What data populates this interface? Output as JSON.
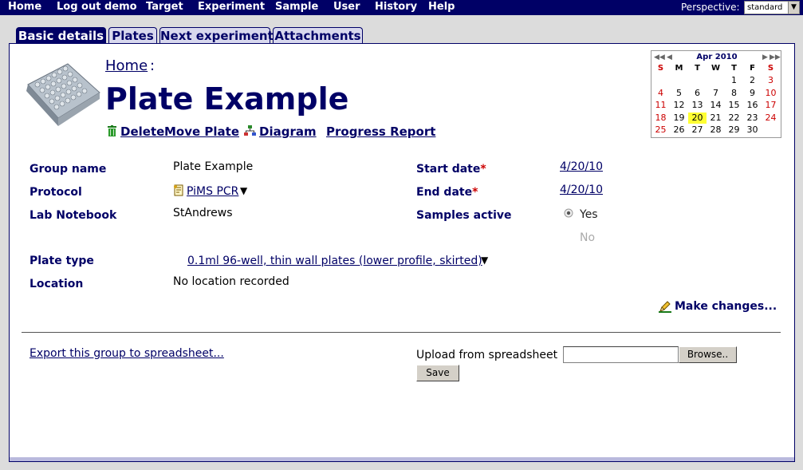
{
  "nav": {
    "items": [
      "Home",
      "Log out demo",
      "Target",
      "Experiment",
      "Sample",
      "User",
      "History",
      "Help"
    ],
    "perspective_label": "Perspective:",
    "perspective_value": "standard"
  },
  "tabs": [
    "Basic details",
    "Plates",
    "Next experiment",
    "Attachments"
  ],
  "breadcrumb": {
    "home": "Home",
    "sep": ":"
  },
  "title": "Plate Example",
  "actions": {
    "delete": "Delete",
    "move": "Move Plate",
    "diagram": "Diagram",
    "progress": "Progress Report"
  },
  "fields": {
    "group_name": {
      "label": "Group name",
      "value": "Plate Example"
    },
    "protocol": {
      "label": "Protocol",
      "value": "PiMS PCR"
    },
    "notebook": {
      "label": "Lab Notebook",
      "value": "StAndrews"
    },
    "plate_type": {
      "label": "Plate type",
      "value": "0.1ml 96-well, thin wall plates (lower profile, skirted)"
    },
    "location": {
      "label": "Location",
      "value": "No location recorded"
    },
    "start_date": {
      "label": "Start date",
      "value": "4/20/10"
    },
    "end_date": {
      "label": "End date",
      "value": "4/20/10"
    },
    "samples_active": {
      "label": "Samples active",
      "yes": "Yes",
      "no": "No",
      "selected": "Yes"
    },
    "required_marker": "*"
  },
  "make_changes": "Make changes...",
  "export_link": "Export this group to spreadsheet...",
  "upload": {
    "label": "Upload from spreadsheet",
    "value": "",
    "browse": "Browse..",
    "save": "Save"
  },
  "calendar": {
    "month_label": "Apr 2010",
    "dow": [
      "S",
      "M",
      "T",
      "W",
      "T",
      "F",
      "S"
    ],
    "weeks": [
      [
        "",
        "",
        "",
        "",
        "1",
        "2",
        "3"
      ],
      [
        "4",
        "5",
        "6",
        "7",
        "8",
        "9",
        "10"
      ],
      [
        "11",
        "12",
        "13",
        "14",
        "15",
        "16",
        "17"
      ],
      [
        "18",
        "19",
        "20",
        "21",
        "22",
        "23",
        "24"
      ],
      [
        "25",
        "26",
        "27",
        "28",
        "29",
        "30",
        ""
      ]
    ],
    "today": "20"
  },
  "colors": {
    "brand": "#000066",
    "weekend": "#cc0000",
    "today": "#ffff33"
  }
}
